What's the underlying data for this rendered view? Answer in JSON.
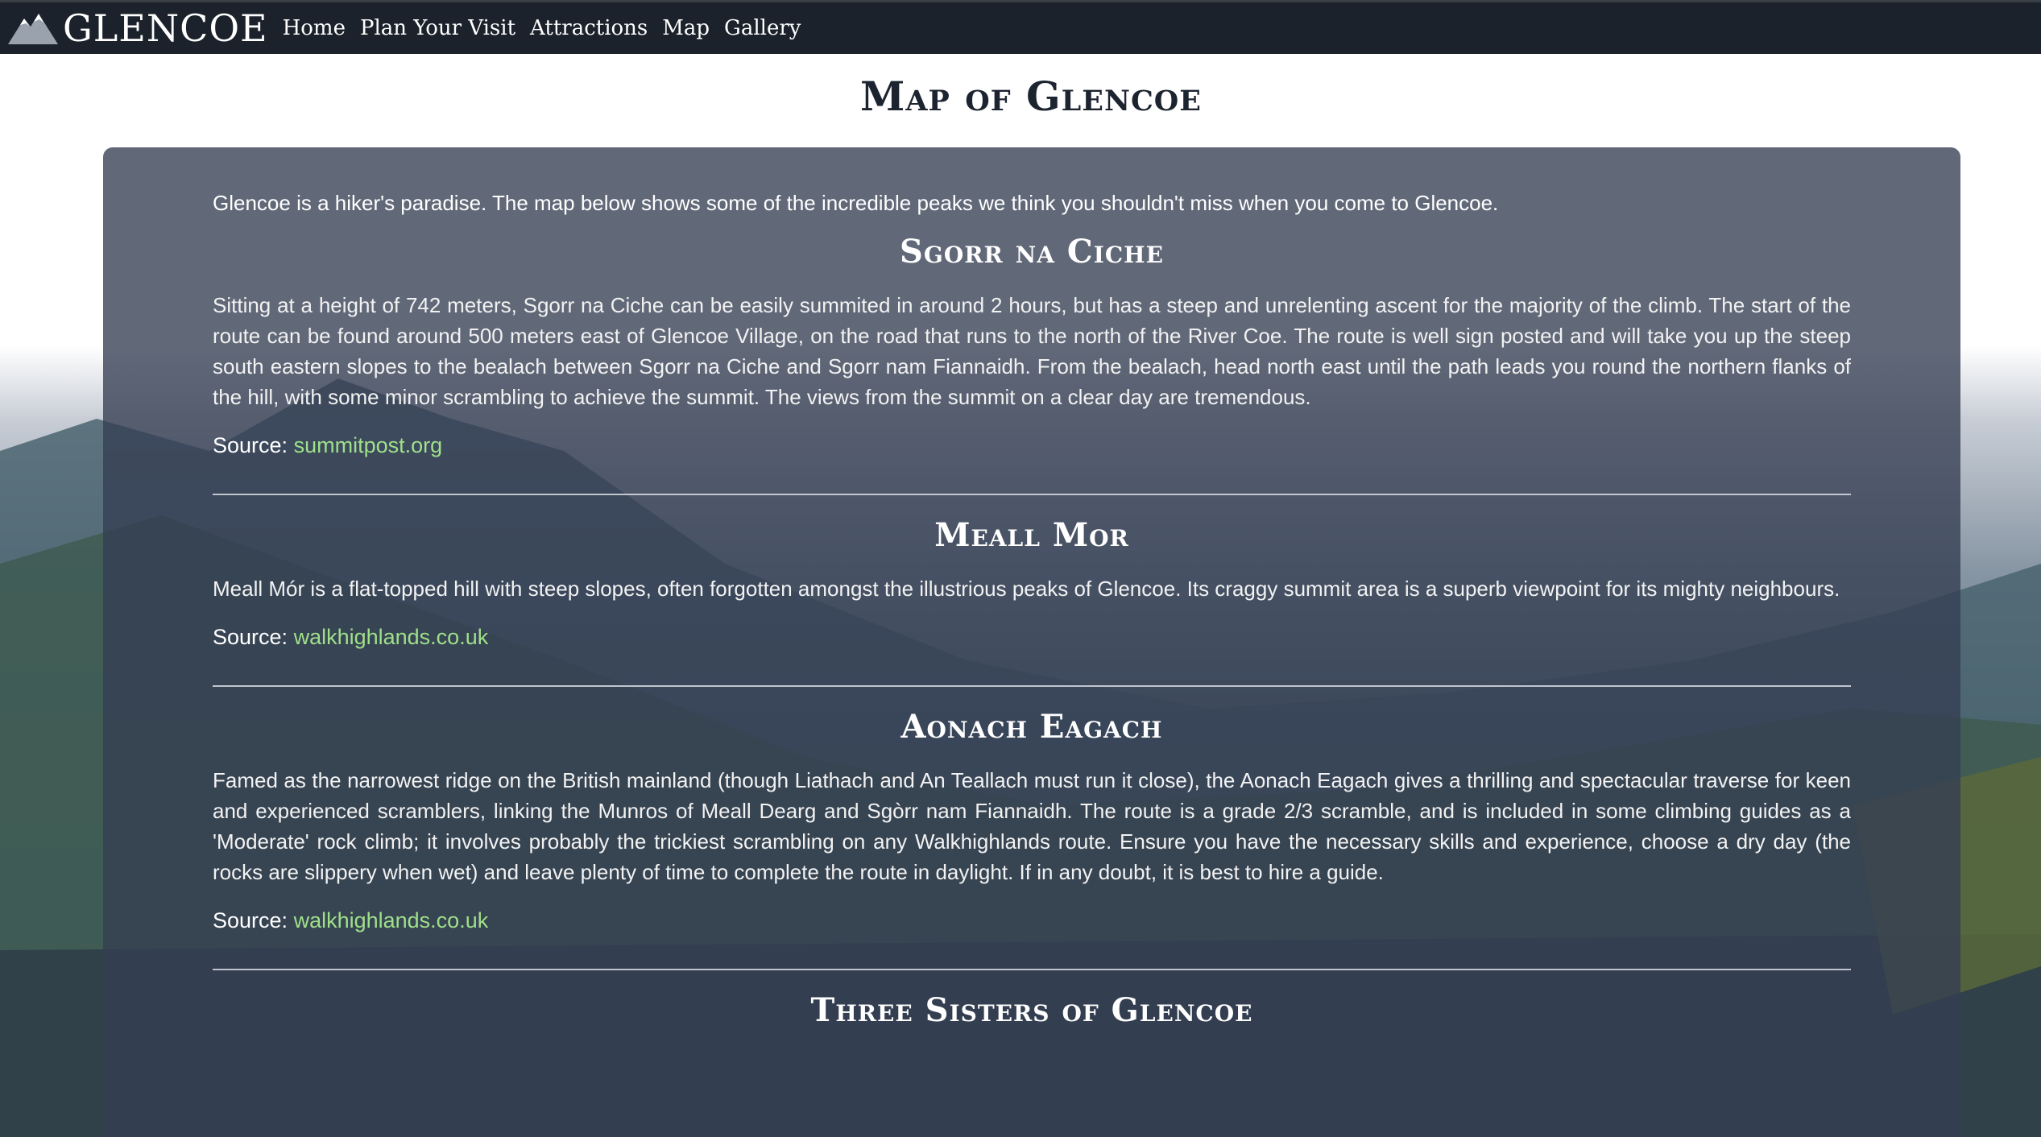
{
  "nav": {
    "brand": "GLENCOE",
    "links": [
      "Home",
      "Plan Your Visit",
      "Attractions",
      "Map",
      "Gallery"
    ]
  },
  "page": {
    "title": "Map of Glencoe",
    "intro": "Glencoe is a hiker's paradise. The map below shows some of the incredible peaks we think you shouldn't miss when you come to Glencoe."
  },
  "peaks": [
    {
      "title": "Sgorr na Ciche",
      "description": "Sitting at a height of 742 meters, Sgorr na Ciche can be easily summited in around 2 hours, but has a steep and unrelenting ascent for the majority of the climb. The start of the route can be found around 500 meters east of Glencoe Village, on the road that runs to the north of the River Coe. The route is well sign posted and will take you up the steep south eastern slopes to the bealach between Sgorr na Ciche and Sgorr nam Fiannaidh. From the bealach, head north east until the path leads you round the northern flanks of the hill, with some minor scrambling to achieve the summit. The views from the summit on a clear day are tremendous.",
      "source_label": "Source:",
      "source_link": "summitpost.org"
    },
    {
      "title": "Meall Mor",
      "description": "Meall Mór is a flat-topped hill with steep slopes, often forgotten amongst the illustrious peaks of Glencoe. Its craggy summit area is a superb viewpoint for its mighty neighbours.",
      "source_label": "Source:",
      "source_link": "walkhighlands.co.uk"
    },
    {
      "title": "Aonach Eagach",
      "description": "Famed as the narrowest ridge on the British mainland (though Liathach and An Teallach must run it close), the Aonach Eagach gives a thrilling and spectacular traverse for keen and experienced scramblers, linking the Munros of Meall Dearg and Sgòrr nam Fiannaidh. The route is a grade 2/3 scramble, and is included in some climbing guides as a 'Moderate' rock climb; it involves probably the trickiest scrambling on any Walkhighlands route. Ensure you have the necessary skills and experience, choose a dry day (the rocks are slippery when wet) and leave plenty of time to complete the route in daylight. If in any doubt, it is best to hire a guide.",
      "source_label": "Source:",
      "source_link": "walkhighlands.co.uk"
    },
    {
      "title": "Three Sisters of Glencoe"
    }
  ],
  "colors": {
    "navbar": "#1b222b",
    "panel": "#343e52",
    "link": "#9fe08a"
  },
  "icons": {
    "logo": "mountain-logo-icon"
  }
}
